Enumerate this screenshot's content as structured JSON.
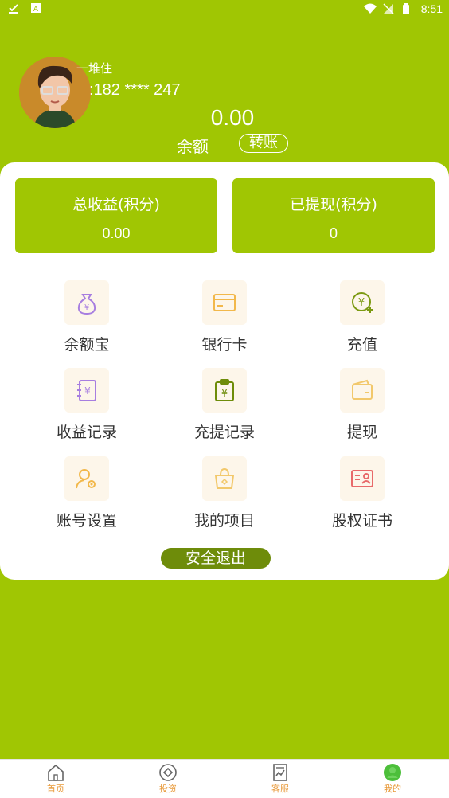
{
  "status": {
    "time": "8:51"
  },
  "profile": {
    "nickname": "一堆住",
    "phone": ":182 **** 247",
    "balance": "0.00",
    "balance_label": "余额",
    "transfer_label": "转账"
  },
  "stats": [
    {
      "title": "总收益(积分)",
      "value": "0.00"
    },
    {
      "title": "已提现(积分)",
      "value": "0"
    }
  ],
  "menu": [
    {
      "label": "余额宝",
      "icon": "money-bag-icon"
    },
    {
      "label": "银行卡",
      "icon": "bank-card-icon"
    },
    {
      "label": "充值",
      "icon": "recharge-icon"
    },
    {
      "label": "收益记录",
      "icon": "income-record-icon"
    },
    {
      "label": "充提记录",
      "icon": "recharge-record-icon"
    },
    {
      "label": "提现",
      "icon": "wallet-icon"
    },
    {
      "label": "账号设置",
      "icon": "account-settings-icon"
    },
    {
      "label": "我的项目",
      "icon": "shopping-bag-icon"
    },
    {
      "label": "股权证书",
      "icon": "certificate-icon"
    }
  ],
  "logout_label": "安全退出",
  "tabs": [
    {
      "label": "首页",
      "icon": "home-icon"
    },
    {
      "label": "投资",
      "icon": "invest-icon"
    },
    {
      "label": "客服",
      "icon": "service-icon"
    },
    {
      "label": "我的",
      "icon": "profile-icon"
    }
  ],
  "colors": {
    "primary": "#a0c603",
    "dark_button": "#6e8c0a",
    "tab_text": "#e89a3a"
  }
}
